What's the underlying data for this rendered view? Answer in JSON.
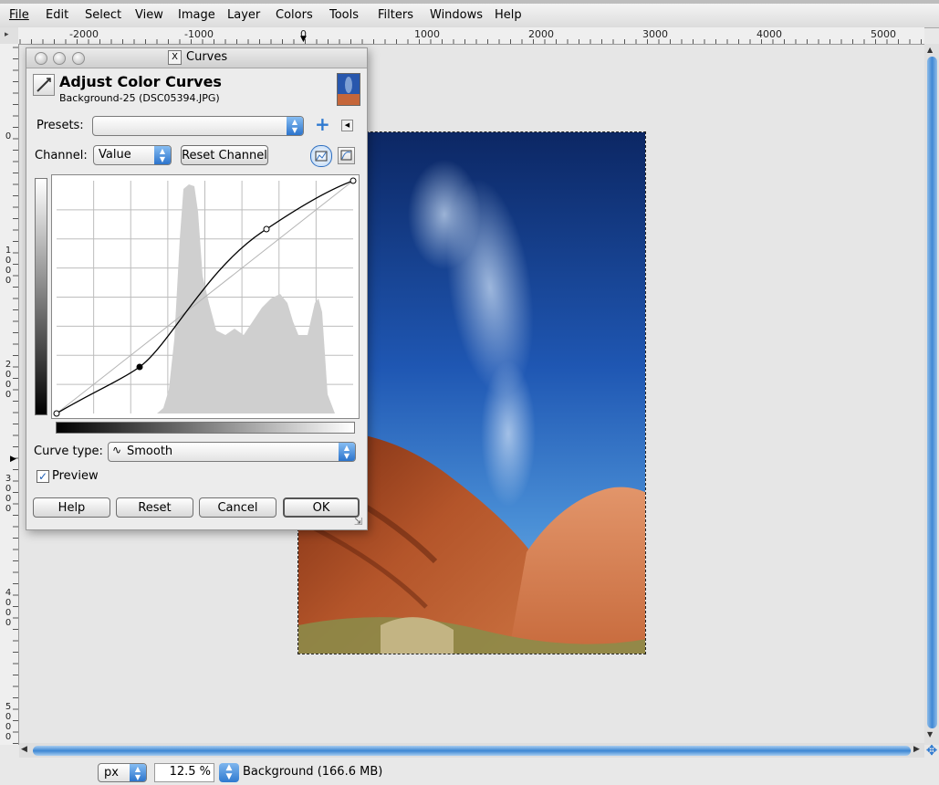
{
  "menubar": {
    "items": [
      "File",
      "Edit",
      "Select",
      "View",
      "Image",
      "Layer",
      "Colors",
      "Tools",
      "Filters",
      "Windows",
      "Help"
    ]
  },
  "rulers": {
    "horizontal": [
      "-2000",
      "-1000",
      "0",
      "1000",
      "2000",
      "3000",
      "4000",
      "5000"
    ],
    "vertical": [
      "0",
      "1000",
      "2000",
      "3000",
      "4000",
      "5000"
    ]
  },
  "dialog": {
    "window_title": "Curves",
    "heading": "Adjust Color Curves",
    "subheading": "Background-25 (DSC05394.JPG)",
    "presets_label": "Presets:",
    "presets_value": "",
    "channel_label": "Channel:",
    "channel_value": "Value",
    "reset_channel_label": "Reset Channel",
    "curve_type_label": "Curve type:",
    "curve_type_value": "Smooth",
    "preview_label": "Preview",
    "preview_checked": true,
    "buttons": {
      "help": "Help",
      "reset": "Reset",
      "cancel": "Cancel",
      "ok": "OK"
    }
  },
  "statusbar": {
    "unit": "px",
    "zoom": "12.5 %",
    "layer_info": "Background (166.6 MB)"
  },
  "colors": {
    "accent_blue": "#3c86d3",
    "sky_dark": "#0c2a6b",
    "rock": "#c8683a"
  }
}
